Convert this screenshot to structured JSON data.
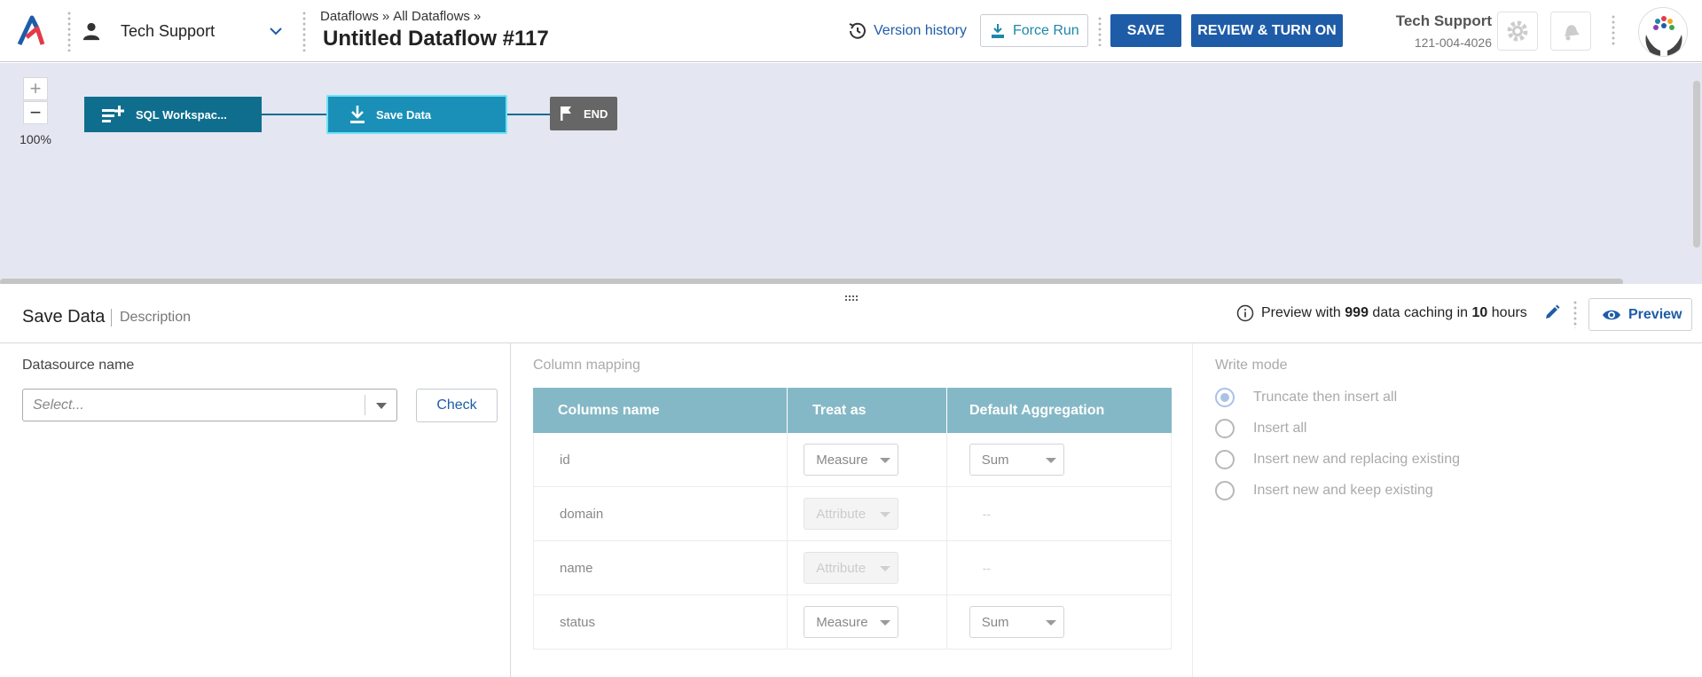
{
  "header": {
    "workspace": "Tech Support",
    "breadcrumb": [
      "Dataflows",
      "»",
      "All Dataflows",
      "»"
    ],
    "title": "Untitled Dataflow #117",
    "version_history": "Version history",
    "force_run": "Force Run",
    "save": "SAVE",
    "review": "REVIEW & TURN ON",
    "account_name": "Tech Support",
    "account_phone": "121-004-4026"
  },
  "canvas": {
    "zoom_in": "+",
    "zoom_out": "−",
    "zoom_level": "100%",
    "nodes": [
      {
        "label": "SQL Workspac...",
        "icon": "sql-add-icon"
      },
      {
        "label": "Save Data",
        "icon": "download-icon"
      },
      {
        "label": "END",
        "icon": "flag-icon"
      }
    ]
  },
  "panel": {
    "title": "Save Data",
    "description": "Description",
    "preview_info": {
      "prefix": "Preview with",
      "rows": "999",
      "mid": "data caching in",
      "hours": "10",
      "suffix": "hours"
    },
    "preview_button": "Preview"
  },
  "datasource": {
    "label": "Datasource name",
    "placeholder": "Select...",
    "check_button": "Check"
  },
  "mapping": {
    "label": "Column mapping",
    "headers": [
      "Columns name",
      "Treat as",
      "Default Aggregation"
    ],
    "rows": [
      {
        "name": "id",
        "treat": "Measure",
        "agg": "Sum",
        "treat_enabled": true
      },
      {
        "name": "domain",
        "treat": "Attribute",
        "agg": "--",
        "treat_enabled": false
      },
      {
        "name": "name",
        "treat": "Attribute",
        "agg": "--",
        "treat_enabled": false
      },
      {
        "name": "status",
        "treat": "Measure",
        "agg": "Sum",
        "treat_enabled": true
      }
    ]
  },
  "write_mode": {
    "label": "Write mode",
    "options": [
      "Truncate then insert all",
      "Insert all",
      "Insert new and replacing existing",
      "Insert new and keep existing"
    ],
    "selected": "Truncate then insert all"
  },
  "colors": {
    "primary": "#1e5ca8",
    "canvas_bg": "#e4e6f2",
    "node_dark": "#0f6e8e",
    "node_active": "#1a90b8",
    "table_header": "#85b8c6"
  }
}
